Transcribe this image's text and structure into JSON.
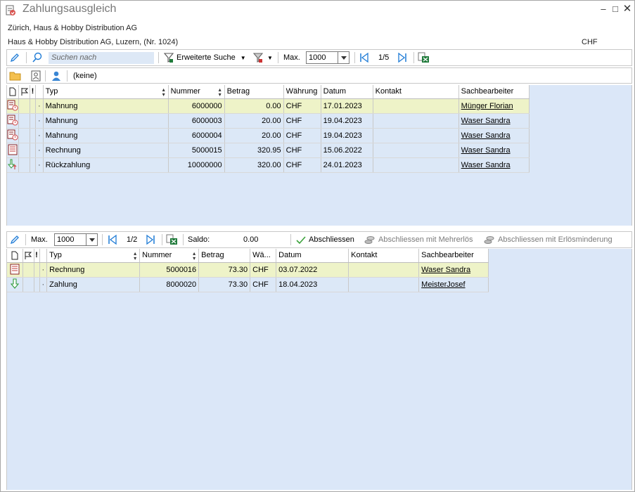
{
  "window": {
    "title": "Zahlungsausgleich"
  },
  "header": {
    "line1": "Zürich, Haus & Hobby Distribution AG",
    "line2": "Haus & Hobby Distribution AG, Luzern, (Nr. 1024)",
    "currency": "CHF"
  },
  "top_toolbar": {
    "search_placeholder": "Suchen nach",
    "extended_search": "Erweiterte Suche",
    "max_label": "Max.",
    "max_value": "1000",
    "page": "1/5"
  },
  "filter_bar": {
    "responsible": "(keine)"
  },
  "top_grid": {
    "columns": [
      "Typ",
      "Nummer",
      "Betrag",
      "Währung",
      "Datum",
      "Kontakt",
      "Sachbearbeiter"
    ],
    "rows": [
      {
        "icon": "reminder-doc-icon",
        "typ": "Mahnung",
        "nummer": "6000000",
        "betrag": "0.00",
        "waehrung": "CHF",
        "datum": "17.01.2023",
        "kontakt": "",
        "sachbearbeiter": "Münger Florian",
        "selected": true
      },
      {
        "icon": "reminder-doc-icon",
        "typ": "Mahnung",
        "nummer": "6000003",
        "betrag": "20.00",
        "waehrung": "CHF",
        "datum": "19.04.2023",
        "kontakt": "",
        "sachbearbeiter": "Waser Sandra"
      },
      {
        "icon": "reminder-doc-icon",
        "typ": "Mahnung",
        "nummer": "6000004",
        "betrag": "20.00",
        "waehrung": "CHF",
        "datum": "19.04.2023",
        "kontakt": "",
        "sachbearbeiter": "Waser Sandra"
      },
      {
        "icon": "invoice-doc-icon",
        "typ": "Rechnung",
        "nummer": "5000015",
        "betrag": "320.95",
        "waehrung": "CHF",
        "datum": "15.06.2022",
        "kontakt": "",
        "sachbearbeiter": "Waser Sandra"
      },
      {
        "icon": "refund-arrow-icon",
        "typ": "Rückzahlung",
        "nummer": "10000000",
        "betrag": "320.00",
        "waehrung": "CHF",
        "datum": "24.01.2023",
        "kontakt": "",
        "sachbearbeiter": "Waser Sandra"
      }
    ]
  },
  "bottom_toolbar": {
    "max_label": "Max.",
    "max_value": "1000",
    "page": "1/2",
    "saldo_label": "Saldo:",
    "saldo_value": "0.00",
    "close_label": "Abschliessen",
    "close_plus_label": "Abschliessen mit Mehrerlös",
    "close_minus_label": "Abschliessen mit Erlösminderung"
  },
  "bottom_grid": {
    "columns": [
      "Typ",
      "Nummer",
      "Betrag",
      "Wä...",
      "Datum",
      "Kontakt",
      "Sachbearbeiter"
    ],
    "rows": [
      {
        "icon": "invoice-doc-icon",
        "typ": "Rechnung",
        "nummer": "5000016",
        "betrag": "73.30",
        "waehrung": "CHF",
        "datum": "03.07.2022",
        "kontakt": "",
        "sachbearbeiter": "Waser Sandra",
        "selected": true
      },
      {
        "icon": "payment-arrow-icon",
        "typ": "Zahlung",
        "nummer": "8000020",
        "betrag": "73.30",
        "waehrung": "CHF",
        "datum": "18.04.2023",
        "kontakt": "",
        "sachbearbeiter": "MeisterJosef"
      }
    ]
  },
  "colors": {
    "grid_bg": "#dbe7f8",
    "selected_row": "#eef3c8",
    "accent_blue": "#1e7bd6",
    "excel_green": "#1f7a3a"
  }
}
